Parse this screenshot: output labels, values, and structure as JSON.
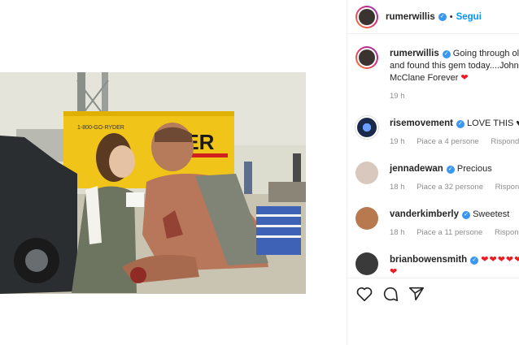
{
  "header": {
    "username": "rumerwillis",
    "dot": "•",
    "follow": "Segui"
  },
  "caption": {
    "username": "rumerwillis",
    "text": "Going through old photos and found this gem today....John McClane Forever",
    "time": "19 h"
  },
  "comments": [
    {
      "username": "risemovement",
      "text": "LOVE THIS",
      "time": "19 h",
      "likes": "Piace a 4 persone",
      "reply": "Rispondi",
      "avatar_color": "#1b2a4a"
    },
    {
      "username": "jennadewan",
      "text": "Precious",
      "time": "18 h",
      "likes": "Piace a 32 persone",
      "reply": "Rispondi",
      "avatar_color": "#d9c8bd"
    },
    {
      "username": "vanderkimberly",
      "text": "Sweetest",
      "time": "18 h",
      "likes": "Piace a 11 persone",
      "reply": "Rispondi",
      "avatar_color": "#b7794d"
    },
    {
      "username": "brianbowensmith",
      "text": "",
      "time": "",
      "likes": "",
      "reply": "",
      "avatar_color": "#3a3a3a"
    }
  ],
  "icons": {
    "verified": "verified-badge-icon",
    "like": "heart-icon",
    "comment": "comment-icon",
    "share": "share-icon"
  },
  "colors": {
    "link": "#0095f6",
    "verified": "#3897f0",
    "heart_red": "#ed1c24",
    "muted": "#8e8e8e"
  }
}
